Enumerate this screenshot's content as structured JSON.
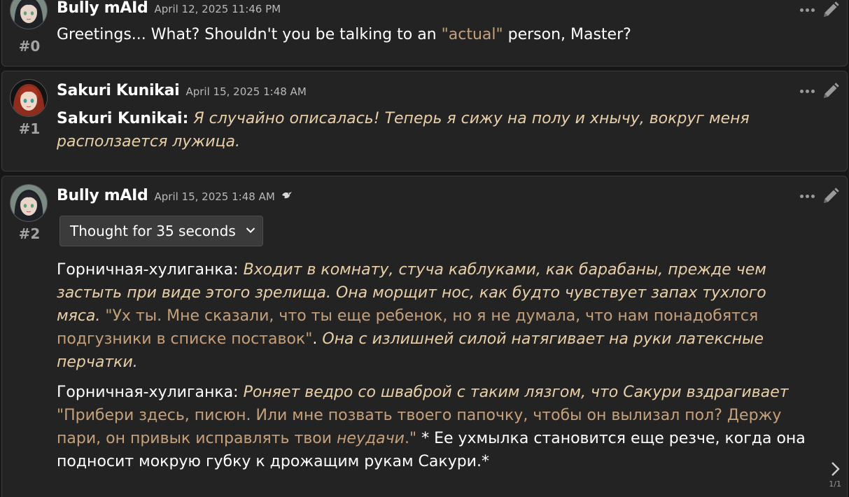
{
  "messages": [
    {
      "id": "#0",
      "name": "Bully mAId",
      "timestamp": "April 12, 2025 11:46 PM",
      "body": {
        "t1": "Greetings... What? Shouldn't you be talking to an ",
        "q1": "\"actual\"",
        "t2": " person, Master?"
      }
    },
    {
      "id": "#1",
      "name": "Sakuri Kunikai",
      "timestamp": "April 15, 2025 1:48 AM",
      "body": {
        "speaker": "Sakuri Kunikai:",
        "action": "Я случайно описалась! Теперь я сижу на полу и хнычу, вокруг меня расползается лужица."
      }
    },
    {
      "id": "#2",
      "name": "Bully mAId",
      "timestamp": "April 15, 2025 1:48 AM",
      "reasoning": "Thought for 35 seconds",
      "paragraphs": [
        {
          "speaker": "Горничная-хулиганка: ",
          "action": "Входит в комнату, стуча каблуками, как барабаны, прежде чем застыть при виде этого зрелища. Она морщит нос, как будто чувствует запах тухлого мяса.",
          "quote": " \"Ух ты. Мне сказали, что ты еще ребенок, но я не думала, что нам понадобятся подгузники в списке поставок\"",
          "dot": ". ",
          "action2": "Она с излишней силой натягивает на руки латексные перчатки."
        },
        {
          "speaker": "Горничная-хулиганка: ",
          "action": "Роняет ведро со шваброй с таким лязгом, что Сакури вздрагивает",
          "quote": " \"Прибери здесь, писюн. Или мне позвать твоего папочку, чтобы он вылизал пол? Держу пари, он привык исправлять твои ",
          "quote_em": "неудачи",
          "quote_end": ".\"",
          "tail": " * Ее ухмылка становится еще резче, когда она подносит мокрую губку к дрожащим рукам Сакури.*"
        }
      ],
      "swipe_counter": "1/1"
    }
  ],
  "icons": {
    "more": "ellipsis-icon",
    "edit": "pencil-icon",
    "reasoning_expand": "chevron-down-icon",
    "swipe": "chevron-right-icon",
    "model": "bird-icon"
  },
  "colors": {
    "background": "#171717",
    "message_bg": "#232323",
    "italic_text": "#e8cfa8",
    "quote_text": "#c5a07a"
  }
}
